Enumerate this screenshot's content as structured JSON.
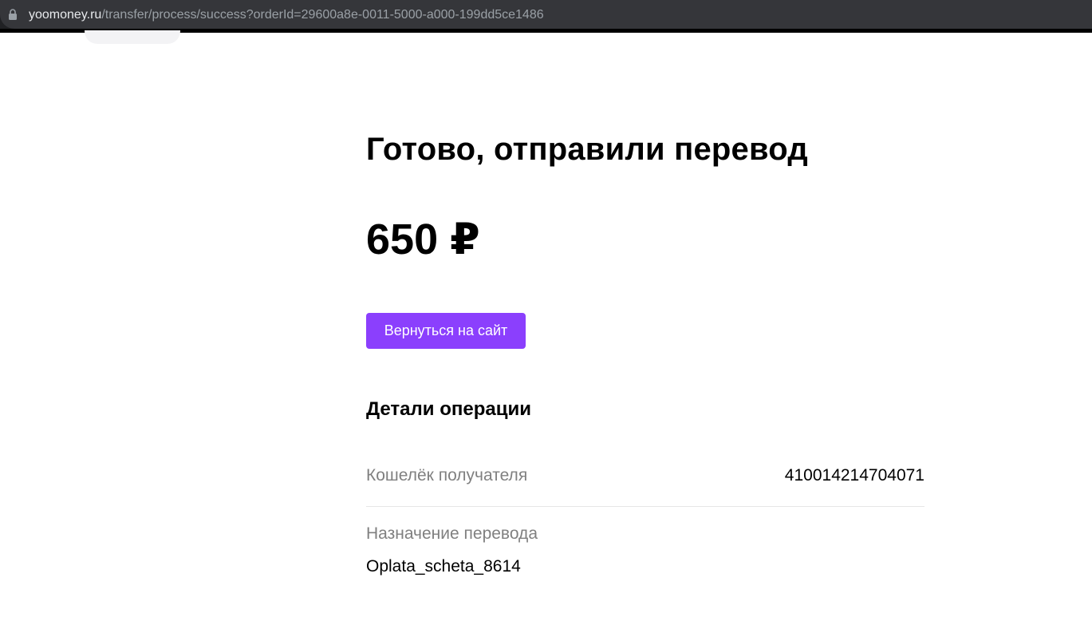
{
  "browser": {
    "url_host": "yoomoney.ru",
    "url_path": "/transfer/process/success?orderId=29600a8e-0011-5000-a000-199dd5ce1486",
    "lock_icon": "lock-icon"
  },
  "page": {
    "title": "Готово, отправили перевод",
    "amount": "650 ₽",
    "back_button_label": "Вернуться на сайт",
    "accent_color": "#8b3ffd"
  },
  "details": {
    "title": "Детали операции",
    "rows": [
      {
        "label": "Кошелёк получателя",
        "value": "410014214704071"
      },
      {
        "label": "Назначение перевода",
        "value": "Oplata_scheta_8614"
      }
    ]
  }
}
